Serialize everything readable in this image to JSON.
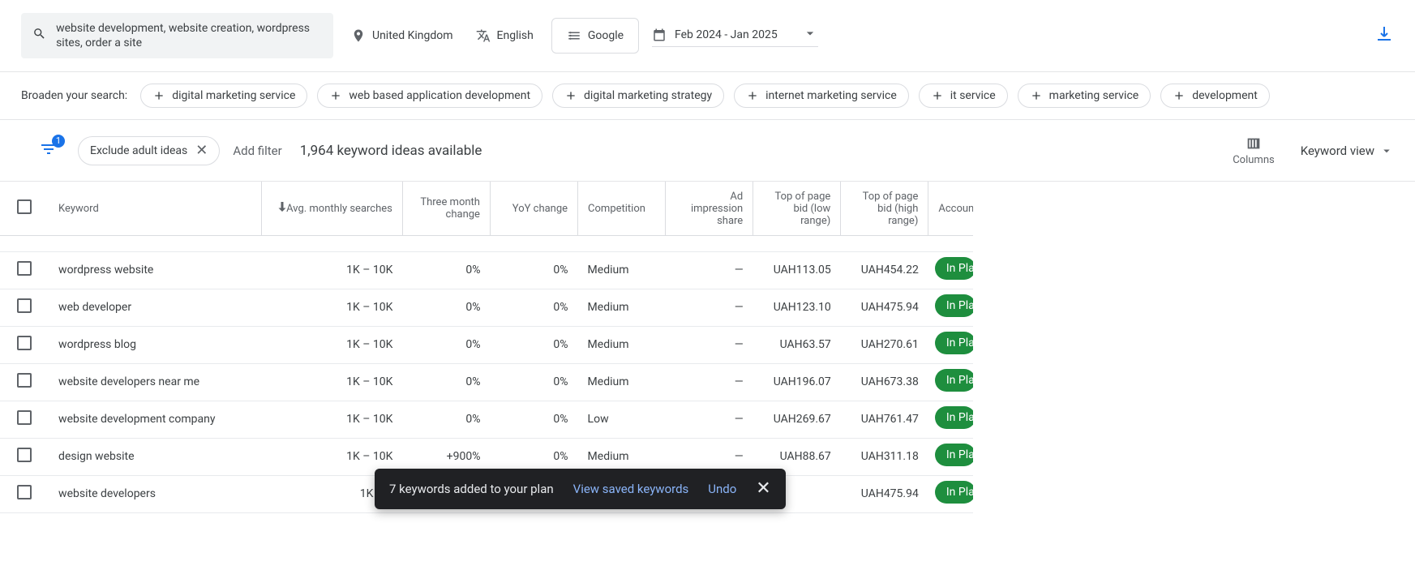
{
  "search": {
    "query": "website development, website creation, wordpress sites, order a site"
  },
  "params": {
    "location": "United Kingdom",
    "language": "English",
    "networks": "Google",
    "date_range": "Feb 2024 - Jan 2025"
  },
  "broaden": {
    "label": "Broaden your search:",
    "suggestions": [
      "digital marketing service",
      "web based application development",
      "digital marketing strategy",
      "internet marketing service",
      "it service",
      "marketing service",
      "development"
    ]
  },
  "controls": {
    "filter_badge": "1",
    "exclude_chip": "Exclude adult ideas",
    "add_filter": "Add filter",
    "ideas_available": "1,964 keyword ideas available",
    "columns_label": "Columns",
    "view_label": "Keyword view"
  },
  "table": {
    "headers": {
      "keyword": "Keyword",
      "avg": "Avg. monthly searches",
      "three": "Three month change",
      "yoy": "YoY change",
      "comp": "Competition",
      "adimp": "Ad impression share",
      "bidlow": "Top of page bid (low range)",
      "bidhigh": "Top of page bid (high range)",
      "acct": "Account"
    },
    "rows": [
      {
        "kw": "wordpress website",
        "avg": "1K – 10K",
        "three": "0%",
        "yoy": "0%",
        "comp": "Medium",
        "adimp": "—",
        "bidlow": "UAH113.05",
        "bidhigh": "UAH454.22",
        "status": "In Plan"
      },
      {
        "kw": "web developer",
        "avg": "1K – 10K",
        "three": "0%",
        "yoy": "0%",
        "comp": "Medium",
        "adimp": "—",
        "bidlow": "UAH123.10",
        "bidhigh": "UAH475.94",
        "status": "In Plan"
      },
      {
        "kw": "wordpress blog",
        "avg": "1K – 10K",
        "three": "0%",
        "yoy": "0%",
        "comp": "Medium",
        "adimp": "—",
        "bidlow": "UAH63.57",
        "bidhigh": "UAH270.61",
        "status": "In Plan"
      },
      {
        "kw": "website developers near me",
        "avg": "1K – 10K",
        "three": "0%",
        "yoy": "0%",
        "comp": "Medium",
        "adimp": "—",
        "bidlow": "UAH196.07",
        "bidhigh": "UAH673.38",
        "status": "In Plan"
      },
      {
        "kw": "website development company",
        "avg": "1K – 10K",
        "three": "0%",
        "yoy": "0%",
        "comp": "Low",
        "adimp": "—",
        "bidlow": "UAH269.67",
        "bidhigh": "UAH761.47",
        "status": "In Plan"
      },
      {
        "kw": "design website",
        "avg": "1K – 10K",
        "three": "+900%",
        "yoy": "0%",
        "comp": "Medium",
        "adimp": "—",
        "bidlow": "UAH88.67",
        "bidhigh": "UAH311.18",
        "status": "In Plan"
      },
      {
        "kw": "website developers",
        "avg": "1K – 1",
        "three": "",
        "yoy": "",
        "comp": "",
        "adimp": "",
        "bidlow": "",
        "bidhigh": "UAH475.94",
        "status": "In Plan"
      }
    ]
  },
  "snackbar": {
    "message": "7 keywords added to your plan",
    "view_link": "View saved keywords",
    "undo": "Undo"
  }
}
